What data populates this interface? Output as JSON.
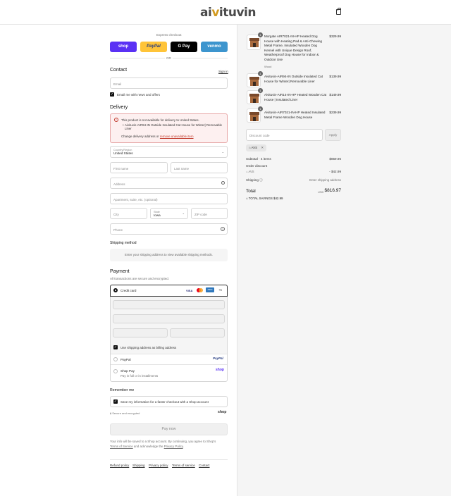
{
  "brand": {
    "logo_prefix": "ai",
    "logo_accent": "v",
    "logo_suffix": "ituvin"
  },
  "express": {
    "label": "Express checkout",
    "buttons": [
      {
        "label": "shop",
        "color": "#5a31f4"
      },
      {
        "label": "PayPal",
        "color": "#ffc439"
      },
      {
        "label": "G Pay",
        "color": "#000000"
      },
      {
        "label": "venmo",
        "color": "#3d95ce"
      }
    ],
    "or": "OR"
  },
  "contact": {
    "title": "Contact",
    "signin": "Sign in",
    "email_placeholder": "Email",
    "news_label": "Email me with news and offers"
  },
  "delivery": {
    "title": "Delivery",
    "error_title": "This product is not available for delivery to United States.",
    "error_item": "Aivituvin-AIR94-IN Outside Insulated Cat House for Winter| Removable Liner",
    "error_action_prefix": "Change delivery address or ",
    "error_action_link": "remove unavailable item",
    "country_label": "Country/Region",
    "country_value": "United States",
    "first_name": "First name",
    "last_name": "Last name",
    "address": "Address",
    "apartment": "Apartment, suite, etc. (optional)",
    "city": "City",
    "state_label": "State",
    "state_value": "Iowa",
    "zip": "ZIP code",
    "phone": "Phone"
  },
  "shipping_method": {
    "title": "Shipping method",
    "note": "Enter your shipping address to view available shipping methods."
  },
  "payment": {
    "title": "Payment",
    "subtitle": "All transactions are secure and encrypted.",
    "credit_card": "Credit card",
    "card_more": "+5",
    "billing_label": "Use shipping address as billing address",
    "paypal": "PayPal",
    "shoppay": "Shop Pay",
    "shoppay_sub": "Pay in full or in installments"
  },
  "remember": {
    "title": "Remember me",
    "save_label": "Save my information for a faster checkout with a Shop account",
    "secure": "Secure and encrypted",
    "shop_logo": "shop"
  },
  "paynow": "Pay now",
  "legal": {
    "line1": "Your info will be saved to a Shop account. By continuing, you agree to Shop's",
    "terms": "Terms of Service",
    "middle": " and acknowledge the ",
    "privacy": "Privacy Policy",
    "end": "."
  },
  "footer_links": [
    "Refund policy",
    "Shipping",
    "Privacy policy",
    "Terms of service",
    "Contact"
  ],
  "cart": {
    "items": [
      {
        "qty": "1",
        "name": "Morgate AIR7021-IN-HP Heated Dog House with Heating Pad & Anti-Chewing Metal Frame, Insulated Wooden Dog Kennel with Unique Design Roof, Weatherproof Dog House for Indoor & Outdoor Use",
        "variant": "Wood",
        "price": "$329.99"
      },
      {
        "qty": "1",
        "name": "Aivituvin-AIR94-IN Outside Insulated Cat House for Winter| Removable Liner",
        "variant": "",
        "price": "$139.99"
      },
      {
        "qty": "1",
        "name": "Aivituvin-AIR14-IN-HP Heated Wooden Cat House | Insulated Liner",
        "variant": "",
        "price": "$149.99"
      },
      {
        "qty": "1",
        "name": "Aivituvin-AIR7021-IN-HP Heated Insulated Metal Frame Wooden Dog House",
        "variant": "",
        "price": "$239.99"
      }
    ],
    "discount_placeholder": "Discount code",
    "apply": "Apply",
    "code": "AVS",
    "subtotal_label": "Subtotal · 4 items",
    "subtotal": "$859.96",
    "order_discount": "Order discount",
    "discount_code": "AVS",
    "discount_amount": "- $42.99",
    "shipping_label": "Shipping",
    "shipping_value": "Enter shipping address",
    "total_label": "Total",
    "currency": "USD",
    "total": "$816.97",
    "savings_label": "TOTAL SAVINGS",
    "savings": "$42.99"
  }
}
